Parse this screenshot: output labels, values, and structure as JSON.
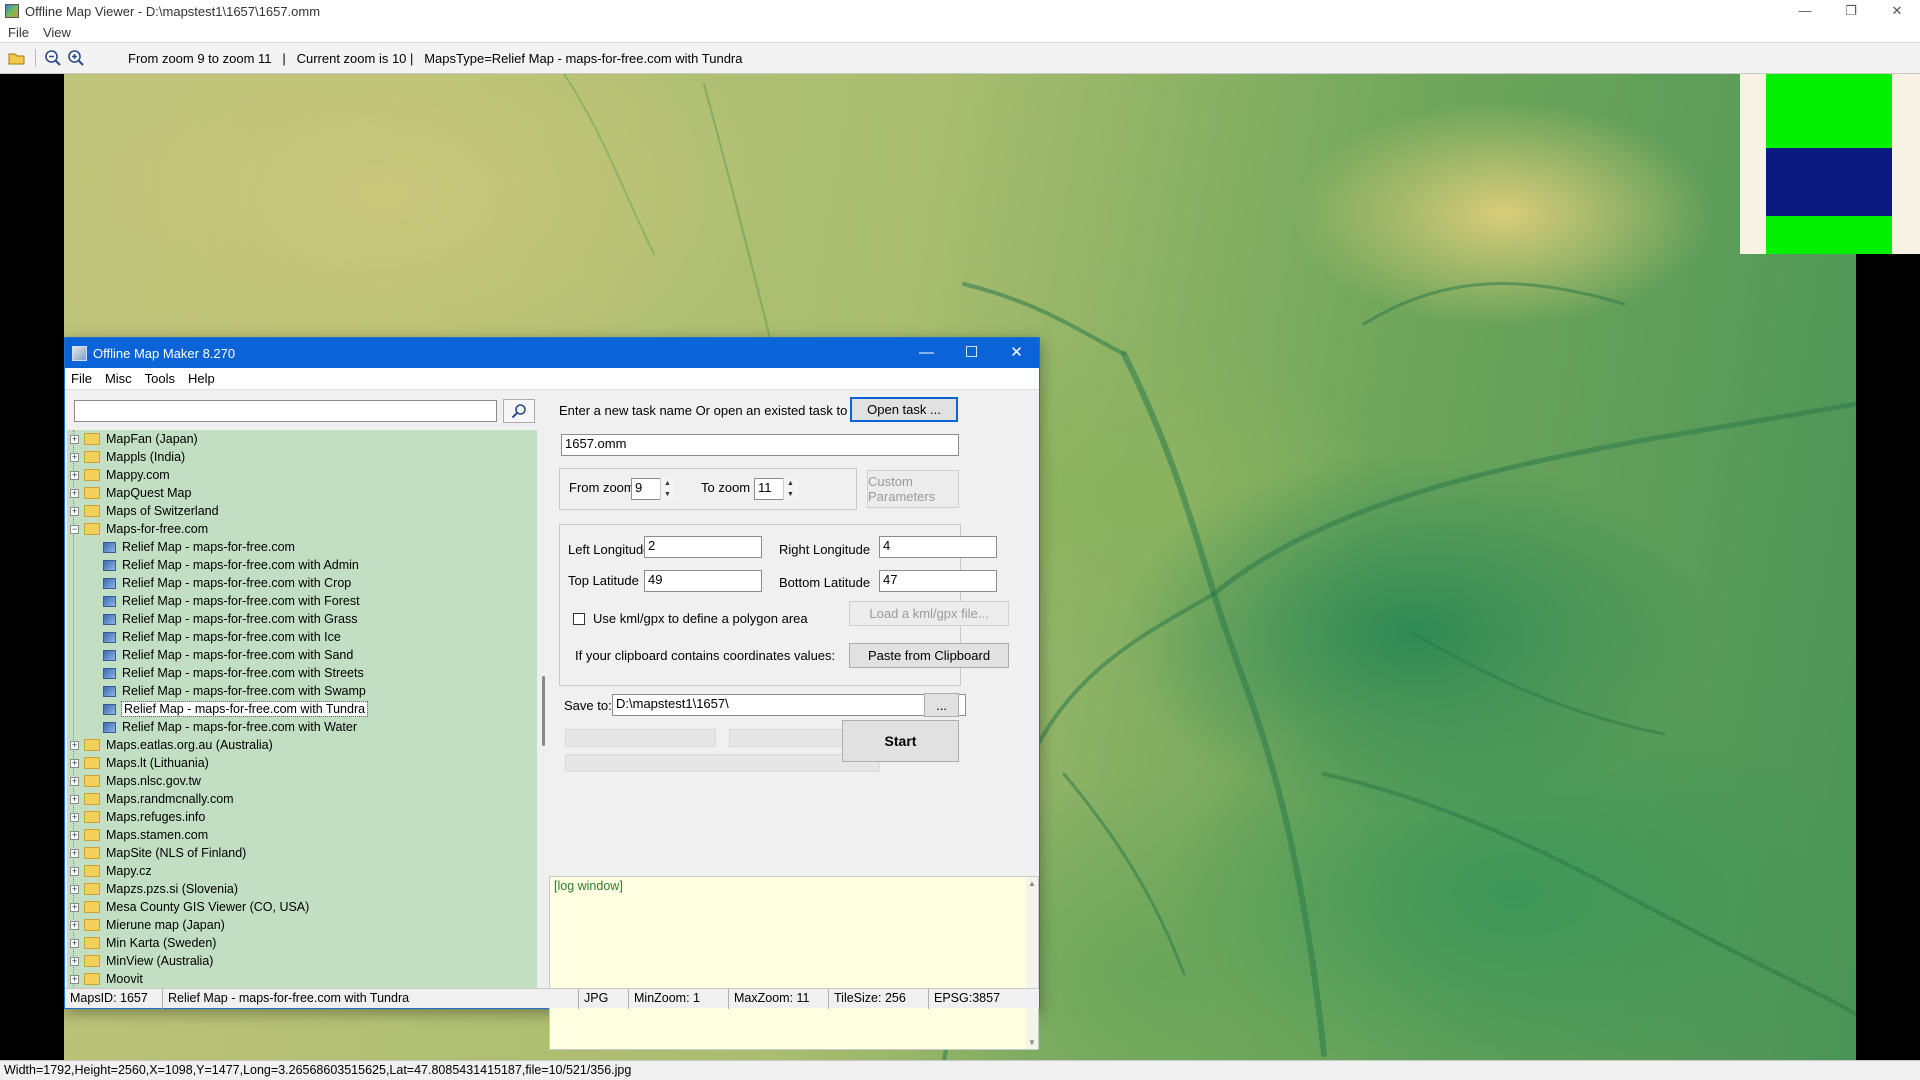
{
  "viewer": {
    "title": "Offline Map Viewer - D:\\mapstest1\\1657\\1657.omm",
    "menu": [
      "File",
      "View"
    ],
    "toolbar": {
      "status_text": "From zoom 9 to zoom 11   |   Current zoom is 10 |   MapsType=Relief Map - maps-for-free.com with Tundra"
    },
    "statusbar": "Width=1792,Height=2560,X=1098,Y=1477,Long=3.26568603515625,Lat=47.8085431415187,file=10/521/356.jpg",
    "icons": [
      "open-folder-icon",
      "zoom-out-icon",
      "zoom-in-icon"
    ],
    "legend_colors": [
      "#00f000",
      "#0a1a80",
      "#00f000"
    ]
  },
  "dialog": {
    "title": "Offline Map Maker 8.270",
    "menu": [
      "File",
      "Misc",
      "Tools",
      "Help"
    ],
    "search": {
      "value": "",
      "placeholder": ""
    },
    "tree": [
      {
        "label": "MapFan (Japan)",
        "level": 0,
        "expander": "+"
      },
      {
        "label": "Mappls (India)",
        "level": 0,
        "expander": "+"
      },
      {
        "label": "Mappy.com",
        "level": 0,
        "expander": "+"
      },
      {
        "label": "MapQuest Map",
        "level": 0,
        "expander": "+"
      },
      {
        "label": "Maps of Switzerland",
        "level": 0,
        "expander": "+"
      },
      {
        "label": "Maps-for-free.com",
        "level": 0,
        "expander": "−",
        "open": true
      },
      {
        "label": "Relief Map - maps-for-free.com",
        "level": 1
      },
      {
        "label": "Relief Map - maps-for-free.com with Admin",
        "level": 1
      },
      {
        "label": "Relief Map - maps-for-free.com with Crop",
        "level": 1
      },
      {
        "label": "Relief Map - maps-for-free.com with Forest",
        "level": 1
      },
      {
        "label": "Relief Map - maps-for-free.com with Grass",
        "level": 1
      },
      {
        "label": "Relief Map - maps-for-free.com with Ice",
        "level": 1
      },
      {
        "label": "Relief Map - maps-for-free.com with Sand",
        "level": 1
      },
      {
        "label": "Relief Map - maps-for-free.com with Streets",
        "level": 1
      },
      {
        "label": "Relief Map - maps-for-free.com with Swamp",
        "level": 1
      },
      {
        "label": "Relief Map - maps-for-free.com with Tundra",
        "level": 1,
        "selected": true
      },
      {
        "label": "Relief Map - maps-for-free.com with Water",
        "level": 1
      },
      {
        "label": "Maps.eatlas.org.au (Australia)",
        "level": 0,
        "expander": "+"
      },
      {
        "label": "Maps.lt (Lithuania)",
        "level": 0,
        "expander": "+"
      },
      {
        "label": "Maps.nlsc.gov.tw",
        "level": 0,
        "expander": "+"
      },
      {
        "label": "Maps.randmcnally.com",
        "level": 0,
        "expander": "+"
      },
      {
        "label": "Maps.refuges.info",
        "level": 0,
        "expander": "+"
      },
      {
        "label": "Maps.stamen.com",
        "level": 0,
        "expander": "+"
      },
      {
        "label": "MapSite (NLS of Finland)",
        "level": 0,
        "expander": "+"
      },
      {
        "label": "Mapy.cz",
        "level": 0,
        "expander": "+"
      },
      {
        "label": "Mapzs.pzs.si (Slovenia)",
        "level": 0,
        "expander": "+"
      },
      {
        "label": "Mesa County GIS Viewer (CO, USA)",
        "level": 0,
        "expander": "+"
      },
      {
        "label": "Mierune map (Japan)",
        "level": 0,
        "expander": "+"
      },
      {
        "label": "Min Karta (Sweden)",
        "level": 0,
        "expander": "+"
      },
      {
        "label": "MinView (Australia)",
        "level": 0,
        "expander": "+"
      },
      {
        "label": "Moovit",
        "level": 0,
        "expander": "+"
      }
    ],
    "task_prompt": "Enter a new task name Or open an existed task to continue:",
    "open_task_label": "Open task ...",
    "task_name": "1657.omm",
    "from_zoom_label": "From zoom",
    "from_zoom_value": "9",
    "to_zoom_label": "To zoom",
    "to_zoom_value": "11",
    "custom_params_label": "Custom Parameters",
    "left_lon_label": "Left Longitude",
    "left_lon_value": "2",
    "right_lon_label": "Right Longitude",
    "right_lon_value": "4",
    "top_lat_label": "Top Latitude",
    "top_lat_value": "49",
    "bottom_lat_label": "Bottom Latitude",
    "bottom_lat_value": "47",
    "kml_checkbox_label": "Use kml/gpx to define a polygon area",
    "load_kml_label": "Load a kml/gpx file...",
    "clipboard_prompt": "If your clipboard contains coordinates values:",
    "paste_clipboard_label": "Paste from Clipboard",
    "save_to_label": "Save to:",
    "save_to_value": "D:\\mapstest1\\1657\\",
    "browse_label": "...",
    "start_label": "Start",
    "log_text": "[log window]",
    "status": {
      "maps_id": "MapsID: 1657",
      "map_name": "Relief Map - maps-for-free.com with Tundra",
      "format": "JPG",
      "min_zoom": "MinZoom: 1",
      "max_zoom": "MaxZoom: 11",
      "tile_size": "TileSize: 256",
      "epsg": "EPSG:3857"
    }
  }
}
